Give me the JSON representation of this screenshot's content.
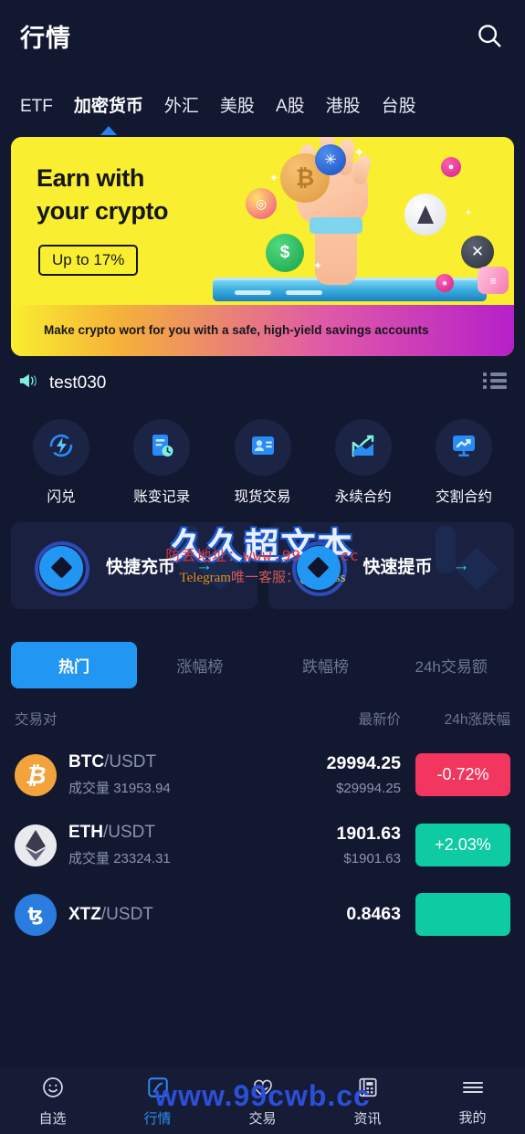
{
  "header": {
    "title": "行情",
    "search_icon": "search-icon"
  },
  "categories": [
    {
      "label": "ETF",
      "active": false
    },
    {
      "label": "加密货币",
      "active": true
    },
    {
      "label": "外汇",
      "active": false
    },
    {
      "label": "美股",
      "active": false
    },
    {
      "label": "A股",
      "active": false
    },
    {
      "label": "港股",
      "active": false
    },
    {
      "label": "台股",
      "active": false
    }
  ],
  "banner": {
    "heading_line1": "Earn with",
    "heading_line2": "your crypto",
    "pill": "Up to 17%",
    "subtitle": "Make crypto wort for you with a safe, high-yield savings accounts",
    "bg_color": "#f9ee2f"
  },
  "notice": {
    "icon": "megaphone-icon",
    "text": "test030",
    "list_icon": "list-icon"
  },
  "quick_menu": [
    {
      "label": "闪兑",
      "icon": "flash-swap-icon"
    },
    {
      "label": "账变记录",
      "icon": "account-history-icon"
    },
    {
      "label": "现货交易",
      "icon": "contact-card-icon"
    },
    {
      "label": "永续合约",
      "icon": "chart-up-icon"
    },
    {
      "label": "交割合约",
      "icon": "monitor-chart-icon"
    }
  ],
  "deposit_withdraw": [
    {
      "label": "快捷充币",
      "arrow": "→",
      "icon": "token-diamond-icon"
    },
    {
      "label": "快速提币",
      "arrow": "→",
      "icon": "token-diamond-icon"
    }
  ],
  "filter_tabs": [
    {
      "label": "热门",
      "active": true
    },
    {
      "label": "涨幅榜",
      "active": false
    },
    {
      "label": "跌幅榜",
      "active": false
    },
    {
      "label": "24h交易额",
      "active": false
    }
  ],
  "table": {
    "headers": {
      "pair": "交易对",
      "price": "最新价",
      "change": "24h涨跌幅"
    },
    "volume_label": "成交量",
    "rows": [
      {
        "base": "BTC",
        "quote": "/USDT",
        "volume": "31953.94",
        "price": "29994.25",
        "price_usd": "$29994.25",
        "change": "-0.72%",
        "direction": "down",
        "icon": "bitcoin-icon"
      },
      {
        "base": "ETH",
        "quote": "/USDT",
        "volume": "23324.31",
        "price": "1901.63",
        "price_usd": "$1901.63",
        "change": "+2.03%",
        "direction": "up",
        "icon": "ethereum-icon"
      },
      {
        "base": "XTZ",
        "quote": "/USDT",
        "volume": "",
        "price": "0.8463",
        "price_usd": "",
        "change": "",
        "direction": "up",
        "icon": "tezos-icon"
      }
    ]
  },
  "bottom_nav": [
    {
      "label": "自选",
      "icon": "smiley-icon",
      "active": false
    },
    {
      "label": "行情",
      "icon": "market-chart-icon",
      "active": true
    },
    {
      "label": "交易",
      "icon": "trade-heart-icon",
      "active": false
    },
    {
      "label": "资讯",
      "icon": "news-icon",
      "active": false
    },
    {
      "label": "我的",
      "icon": "menu-lines-icon",
      "active": false
    }
  ],
  "watermark": {
    "main": "久久超文本",
    "url": "防丢地址：www.99cwb.cc",
    "tg_prefix": "Telegram",
    "tg_mid": "唯一客服：",
    "tg_handle": "@cwbss",
    "bottom": "www.99cwb.cc"
  },
  "colors": {
    "accent": "#2196f3",
    "up": "#0ecba4",
    "down": "#f2365f",
    "background": "#131831",
    "banner": "#f9ee2f"
  }
}
